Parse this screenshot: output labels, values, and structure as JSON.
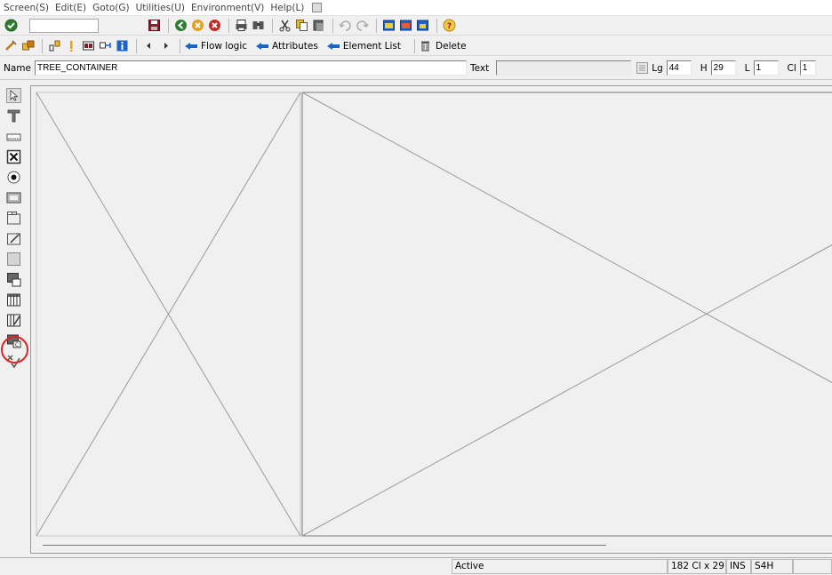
{
  "menu": [
    "Screen(S)",
    "Edit(E)",
    "Goto(G)",
    "Utilities(U)",
    "Environment(V)",
    "Help(L)"
  ],
  "toolbar2": {
    "flow_logic": "Flow logic",
    "attributes": "Attributes",
    "element_list": "Element List",
    "delete": "Delete"
  },
  "namerow": {
    "name_label": "Name",
    "name_value": "TREE_CONTAINER",
    "text_label": "Text",
    "text_value": "",
    "lg_label": "Lg",
    "lg_value": "44",
    "h_label": "H",
    "h_value": "29",
    "l_label": "L",
    "l_value": "1",
    "cl_label": "Cl",
    "cl_value": "1"
  },
  "status": {
    "mode": "Active",
    "size": "182 Cl x 29 L",
    "ins": "INS",
    "system": "S4H"
  },
  "colors": {
    "accent": "#1c63c7",
    "highlight": "#e52222"
  }
}
